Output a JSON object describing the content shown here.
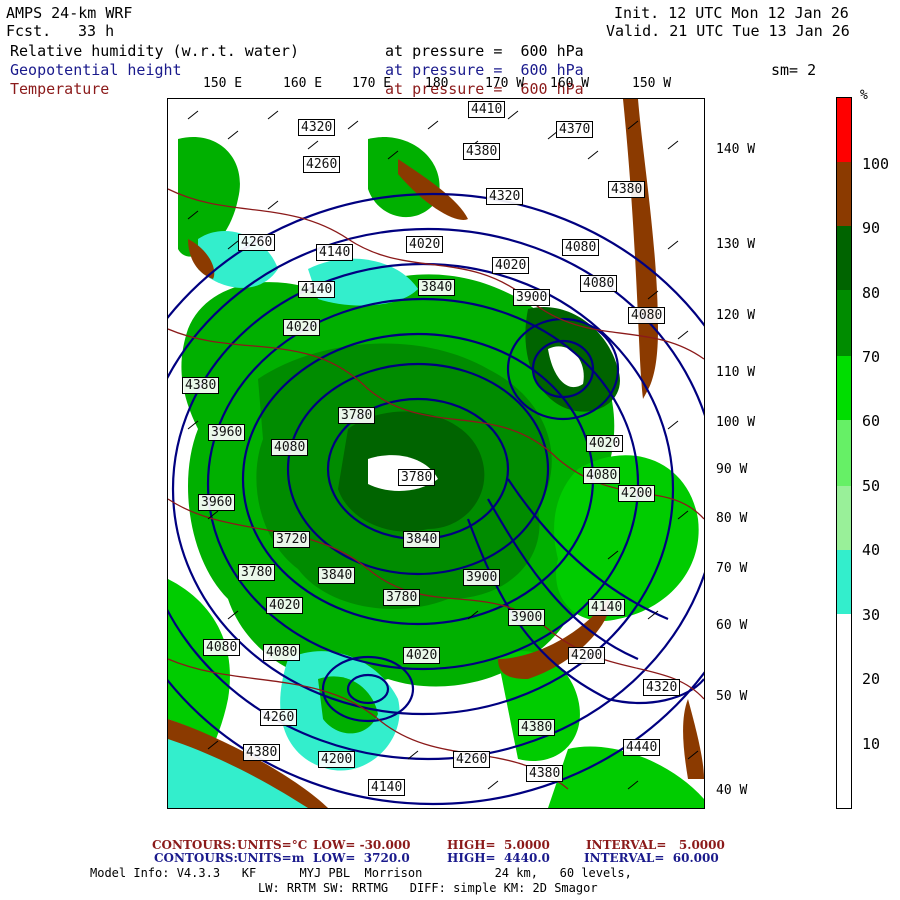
{
  "header": {
    "model": "AMPS 24-km WRF",
    "fcst_label": "Fcst.",
    "fcst_value": "33 h",
    "init": "Init. 12 UTC Mon 12 Jan 26",
    "valid": "Valid. 21 UTC Tue 13 Jan 26",
    "fields": [
      {
        "name": "Relative humidity (w.r.t. water)",
        "level": "at pressure =  600 hPa",
        "color": "#000000"
      },
      {
        "name": "Geopotential height",
        "level": "at pressure =  600 hPa",
        "color": "#1a1a8c"
      },
      {
        "name": "Temperature",
        "level": "at pressure =  600 hPa",
        "color": "#8b1a1a"
      }
    ],
    "smoothing": "sm= 2"
  },
  "map": {
    "top_lon_labels": [
      "150 E",
      "160 E",
      "170 E",
      "180",
      "170 W",
      "160 W",
      "150 W"
    ],
    "right_lat_labels": [
      "140 W",
      "130 W",
      "120 W",
      "110 W",
      "100 W",
      "90 W",
      "80 W",
      "70 W",
      "60 W",
      "50 W",
      "40 W"
    ],
    "height_labels": [
      "4410",
      "4320",
      "4370",
      "4260",
      "4380",
      "4320",
      "4380",
      "4260",
      "4140",
      "4020",
      "4020",
      "4080",
      "4140",
      "4080",
      "3840",
      "4020",
      "3900",
      "4080",
      "4380",
      "3780",
      "3960",
      "4020",
      "4080",
      "3960",
      "3720",
      "3840",
      "3780",
      "4080",
      "4200",
      "3780",
      "3840",
      "3900",
      "4020",
      "4140",
      "3780",
      "4080",
      "3900",
      "4080",
      "4200",
      "4020",
      "4320",
      "4260",
      "4380",
      "4200",
      "4380",
      "4260",
      "4380",
      "4140",
      "4440"
    ],
    "contour_color_height": "#000080",
    "contour_color_temp": "#8b1a1a"
  },
  "legend": {
    "unit": "%",
    "levels": [
      "100",
      "90",
      "80",
      "70",
      "60",
      "50",
      "40",
      "30",
      "20",
      "10"
    ],
    "colors": [
      "#ff0000",
      "#8b3a00",
      "#006400",
      "#008c00",
      "#00dd00",
      "#66f066",
      "#99f099",
      "#33eecc",
      "#ffffff",
      "#ffffff",
      "#ffffff"
    ]
  },
  "footer": {
    "line1": {
      "label": "CONTOURS:",
      "units": "UNITS=°C",
      "low": "LOW= -30.000",
      "high": "HIGH=  5.0000",
      "interval": "INTERVAL=   5.0000"
    },
    "line2": {
      "label": "CONTOURS:",
      "units": "UNITS=m",
      "low": "LOW=  3720.0",
      "high": "HIGH=  4440.0",
      "interval": "INTERVAL=  60.000"
    },
    "model_info": "Model Info: V4.3.3   KF      MYJ PBL  Morrison          24 km,   60 levels,",
    "model_info2": "LW: RRTM SW: RRTMG   DIFF: simple KM: 2D Smagor"
  }
}
